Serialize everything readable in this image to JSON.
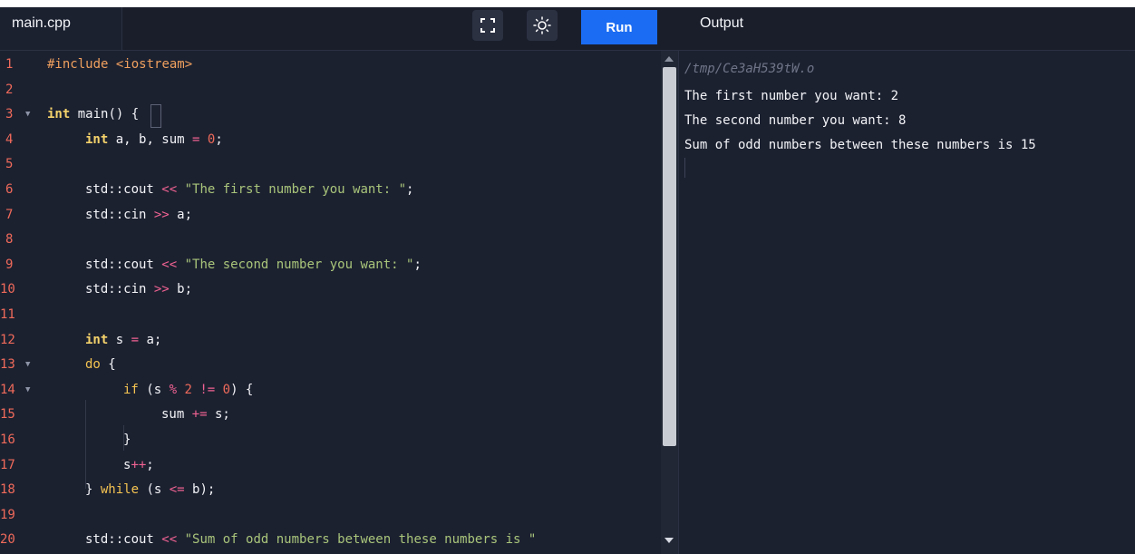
{
  "editor": {
    "filename": "main.cpp",
    "run_label": "Run",
    "fullscreen_icon": "fullscreen-icon",
    "theme_icon": "sun-icon",
    "line_numbers": [
      "1",
      "2",
      "3",
      "4",
      "5",
      "6",
      "7",
      "8",
      "9",
      "10",
      "11",
      "12",
      "13",
      "14",
      "15",
      "16",
      "17",
      "18",
      "19",
      "20"
    ],
    "code": {
      "l1_directive": "#include",
      "l1_header": "<iostream>",
      "l3_type": "int",
      "l3_rest": " main() {",
      "l4_type": "int",
      "l4_decl": " a, b, sum ",
      "l4_eq": "=",
      "l4_zero": "0",
      "l4_semi": ";",
      "l6_obj": "std::cout ",
      "l6_op": "<<",
      "l6_str": "\"The first number you want: \"",
      "l6_semi": ";",
      "l7_obj": "std::cin ",
      "l7_op": ">>",
      "l7_rest": " a;",
      "l9_obj": "std::cout ",
      "l9_op": "<<",
      "l9_str": "\"The second number you want: \"",
      "l9_semi": ";",
      "l10_obj": "std::cin ",
      "l10_op": ">>",
      "l10_rest": " b;",
      "l12_type": "int",
      "l12_mid": " s ",
      "l12_eq": "=",
      "l12_rest": " a;",
      "l13_kw": "do",
      "l13_rest": " {",
      "l14_kw": "if",
      "l14_a": " (s ",
      "l14_mod": "%",
      "l14_two": "2",
      "l14_ne": "!=",
      "l14_zero": "0",
      "l14_rest": ") {",
      "l15_a": "sum ",
      "l15_op": "+=",
      "l15_rest": " s;",
      "l16": "}",
      "l17_a": "s",
      "l17_op": "++",
      "l17_rest": ";",
      "l18_a": "} ",
      "l18_kw": "while",
      "l18_b": " (s ",
      "l18_op": "<=",
      "l18_rest": " b);",
      "l20_obj": "std::cout ",
      "l20_op": "<<",
      "l20_str": "\"Sum of odd numbers between these numbers is \""
    }
  },
  "output": {
    "title": "Output",
    "lines": [
      "/tmp/Ce3aH539tW.o",
      "The first number you want: 2",
      "The second number you want: 8",
      "Sum of odd numbers between these numbers is 15"
    ]
  }
}
